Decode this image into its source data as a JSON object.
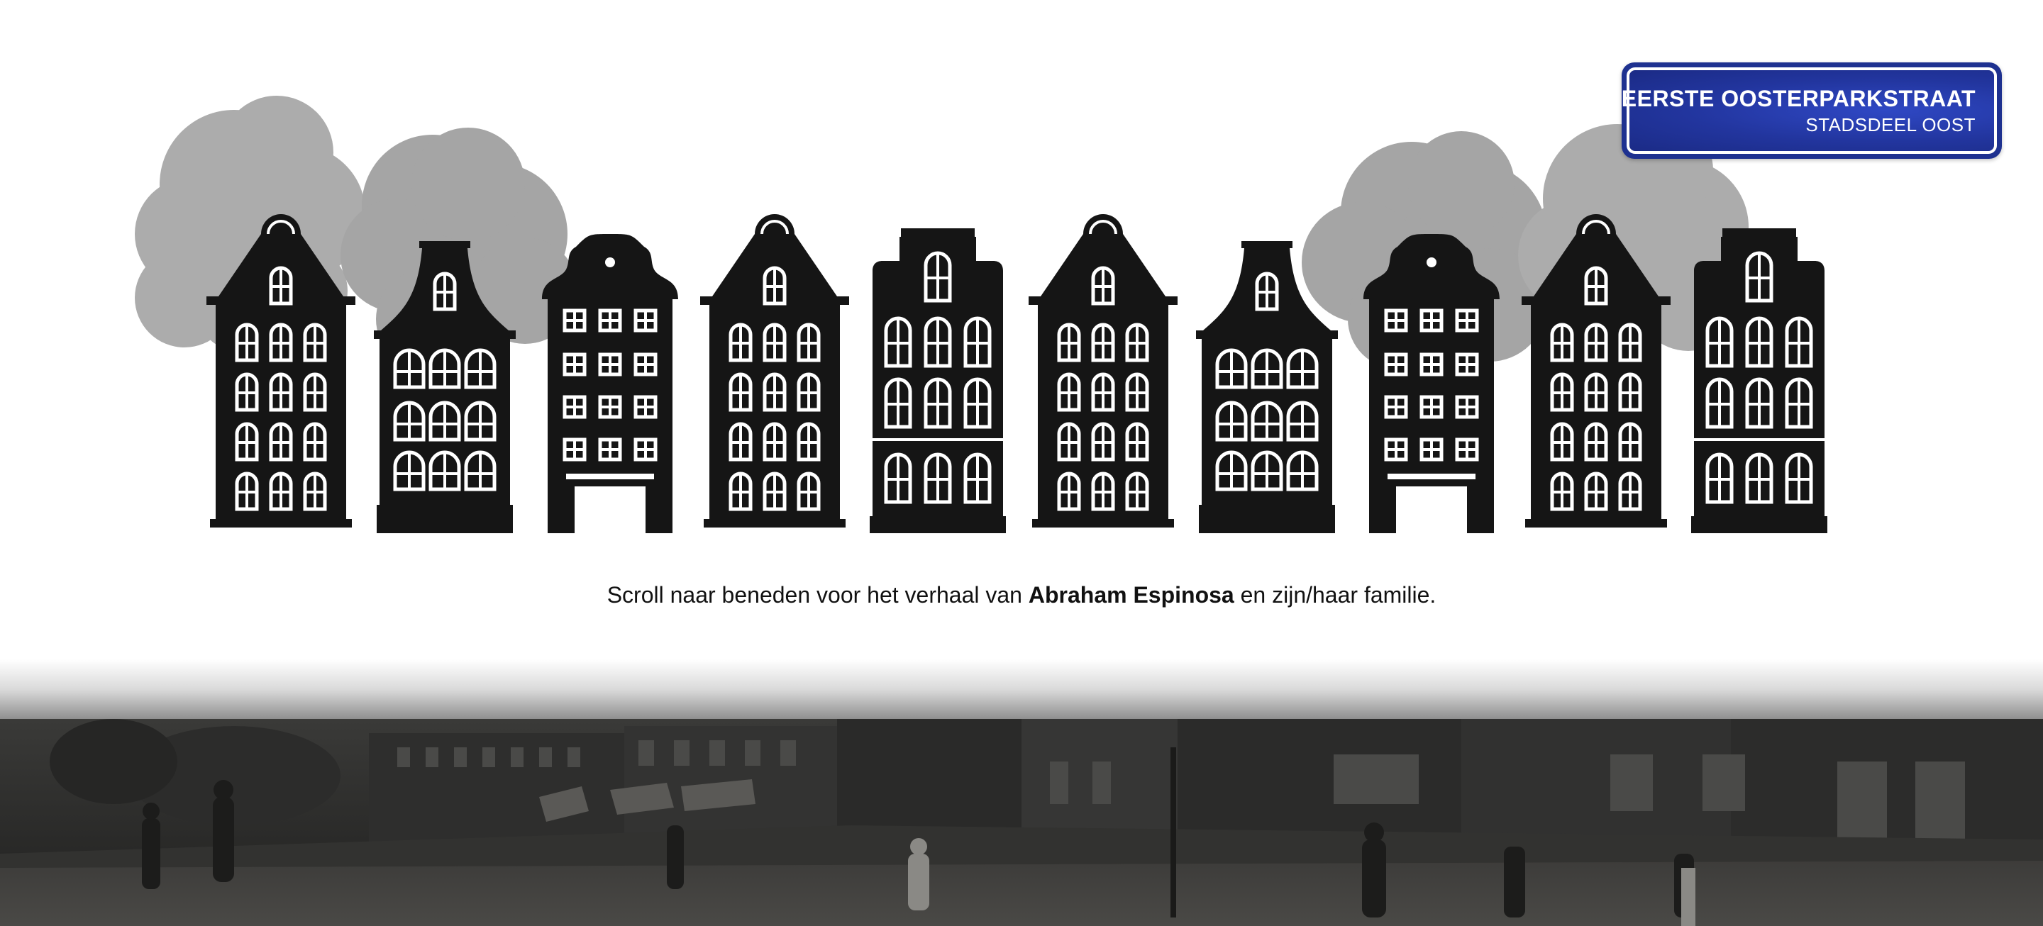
{
  "street_sign": {
    "street": "EERSTE OOSTERPARKSTRAAT",
    "district": "STADSDEEL OOST",
    "color": "#1e3190"
  },
  "skyline": {
    "house_color": "#151515",
    "tree_color": "#a9a9a9"
  },
  "caption": {
    "before": "Scroll naar beneden voor het verhaal van ",
    "name": "Abraham Espinosa",
    "after": " en zijn/haar familie."
  },
  "photo": {
    "tone": "sepia-black-and-white"
  }
}
